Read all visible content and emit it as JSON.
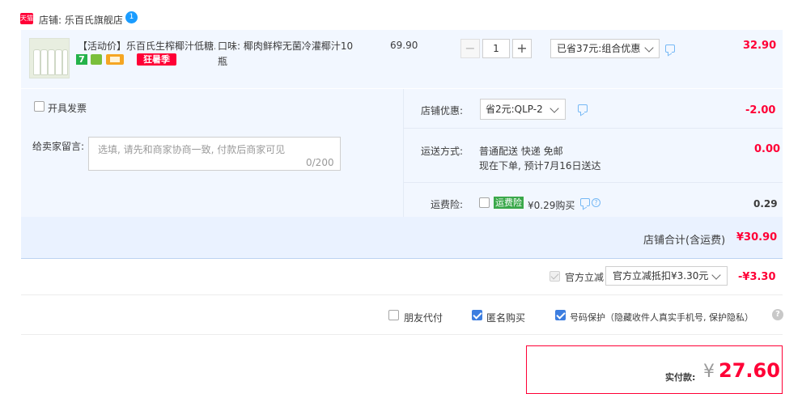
{
  "store": {
    "logo_text": "天猫",
    "label": "店铺: 乐百氏旗舰店"
  },
  "item": {
    "title": "【活动价】乐百氏生榨椰汁低糖...",
    "promo_badge": "狂暑季",
    "badge_7": "7",
    "flavor": "口味: 椰肉鲜榨无菌冷灌椰汁10瓶",
    "unit_price": "69.90",
    "qty_minus": "−",
    "quantity": "1",
    "qty_plus": "+",
    "discount_option": "已省37元:组合优惠",
    "total": "32.90"
  },
  "invoice": {
    "label": "开具发票"
  },
  "message": {
    "label": "给卖家留言:",
    "placeholder": "选填, 请先和商家协商一致, 付款后商家可见",
    "counter": "0/200"
  },
  "shop_discount": {
    "label": "店铺优惠:",
    "option": "省2元:QLP-2",
    "amount": "-2.00"
  },
  "shipping": {
    "label": "运送方式:",
    "line1": "普通配送 快递 免邮",
    "line2": "现在下单, 预计7月16日送达",
    "amount": "0.00"
  },
  "insurance": {
    "label": "运费险:",
    "tag": "运费险",
    "price_text": "¥0.29购买",
    "amount": "0.29"
  },
  "store_total": {
    "label": "店铺合计(含运费)",
    "amount": "¥30.90"
  },
  "official": {
    "label": "官方立减",
    "option": "官方立减抵扣¥3.30元",
    "amount": "-¥3.30"
  },
  "options": {
    "friend_pay": "朋友代付",
    "anonymous": "匿名购买",
    "number_protect": "号码保护（隐藏收件人真实手机号, 保护隐私）",
    "help": "?"
  },
  "payment": {
    "label": "实付款:",
    "currency": "¥",
    "amount": "27.60"
  }
}
